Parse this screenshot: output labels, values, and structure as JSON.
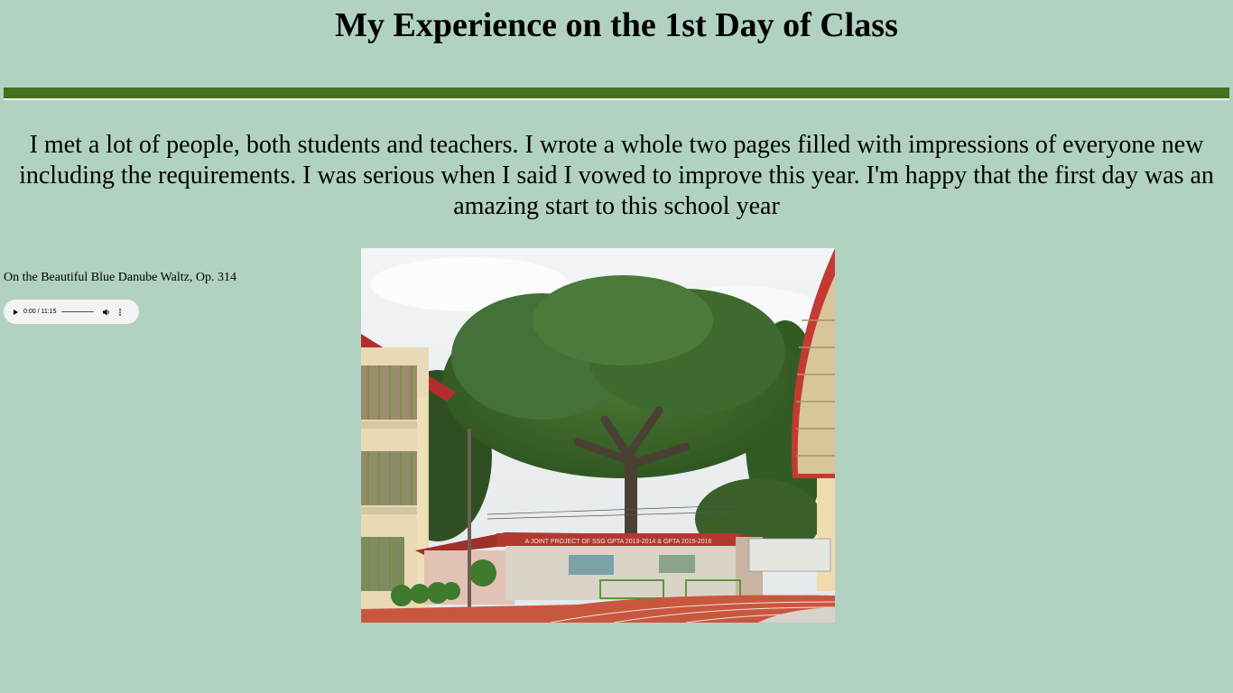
{
  "page": {
    "title": "My Experience on the 1st Day of Class",
    "intro": "I met a lot of people, both students and teachers. I wrote a whole two pages filled with impressions of everyone new including the requirements. I was serious when I said I vowed to improve this year. I'm happy that the first day was an amazing start to this school year"
  },
  "audio": {
    "track_title": "On the Beautiful Blue Danube Waltz, Op. 314",
    "time": "0:00 / 11:15",
    "progress": 0
  },
  "photo": {
    "sign_text": "A JOINT PROJECT OF SSG GPTA 2013-2014 & GPTA 2015-2016"
  },
  "colors": {
    "background": "#b1d2c1",
    "divider": "#476f1e"
  }
}
